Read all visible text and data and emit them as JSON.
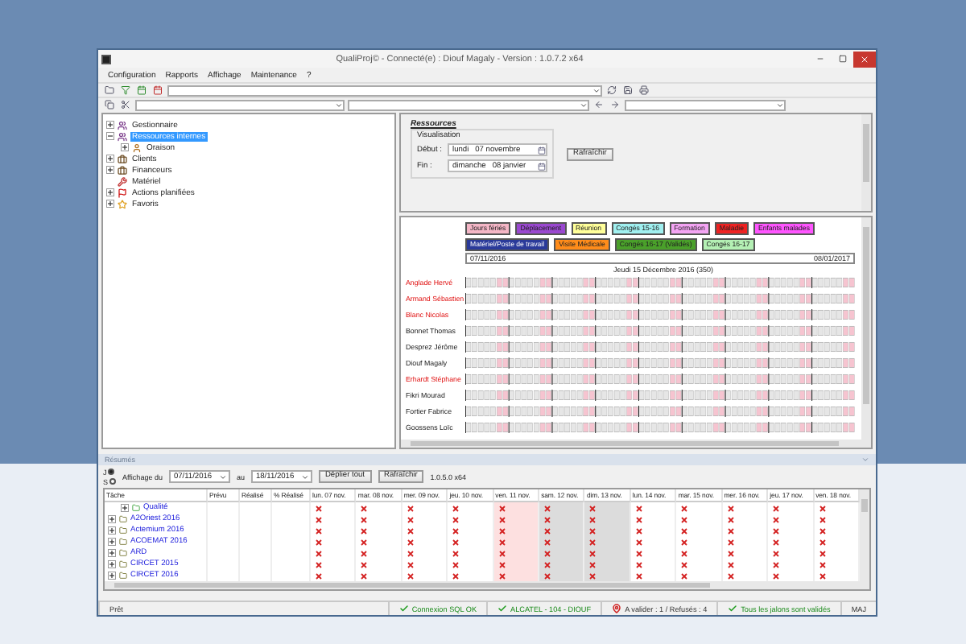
{
  "window": {
    "title": "QualiProj© - Connecté(e) : Diouf Magaly - Version : 1.0.7.2 x64"
  },
  "menu": [
    "Configuration",
    "Rapports",
    "Affichage",
    "Maintenance",
    "?"
  ],
  "tree": [
    {
      "label": "Gestionnaire",
      "kind": "group",
      "selected": false,
      "expanded": false
    },
    {
      "label": "Ressources internes",
      "kind": "group",
      "selected": true,
      "expanded": true,
      "children": [
        {
          "label": "Oraison",
          "kind": "person",
          "selected": false,
          "expanded": false
        }
      ]
    },
    {
      "label": "Clients",
      "kind": "client",
      "selected": false,
      "expanded": false
    },
    {
      "label": "Financeurs",
      "kind": "client",
      "selected": false,
      "expanded": false
    },
    {
      "label": "Matériel",
      "kind": "tool",
      "selected": false
    },
    {
      "label": "Actions planifiées",
      "kind": "flag",
      "selected": false,
      "expanded": false
    },
    {
      "label": "Favoris",
      "kind": "star",
      "selected": false,
      "expanded": false
    }
  ],
  "resources": {
    "title": "Ressources",
    "group": "Visualisation",
    "start": {
      "label": "Début :",
      "day": "lundi",
      "date": "07 novembre"
    },
    "end": {
      "label": "Fin :",
      "day": "dimanche",
      "date": "08 janvier"
    },
    "button": "Rafraîchir"
  },
  "planning": {
    "legend": [
      {
        "label": "Jours fériés",
        "color": "#f4b6c6"
      },
      {
        "label": "Déplacement",
        "color": "#9a48d0"
      },
      {
        "label": "Réunion",
        "color": "#ffff99"
      },
      {
        "label": "Congés 15-16",
        "color": "#a0f0f0"
      },
      {
        "label": "Formation",
        "color": "#f4a4f4"
      },
      {
        "label": "Maladie",
        "color": "#ee2222"
      },
      {
        "label": "Enfants malades",
        "color": "#ff55ff"
      },
      {
        "label": "Matériel/Poste de travail",
        "color": "#2a3a9a"
      },
      {
        "label": "Visite Médicale",
        "color": "#ff8c1a"
      },
      {
        "label": "Congés 16-17 (Validés)",
        "color": "#4aa02a"
      },
      {
        "label": "Congés 16-17",
        "color": "#b4f0b4"
      }
    ],
    "range_start": "07/11/2016",
    "range_end": "08/01/2017",
    "focus_date": "Jeudi 15 Décembre 2016 (350)",
    "rows": [
      {
        "name": "Anglade Hervé",
        "flagged": true
      },
      {
        "name": "Armand Sébastien",
        "flagged": true
      },
      {
        "name": "Blanc Nicolas",
        "flagged": true
      },
      {
        "name": "Bonnet Thomas",
        "flagged": false
      },
      {
        "name": "Desprez Jérôme",
        "flagged": false
      },
      {
        "name": "Diouf Magaly",
        "flagged": false
      },
      {
        "name": "Erhardt Stéphane",
        "flagged": true
      },
      {
        "name": "Fikri Mourad",
        "flagged": false
      },
      {
        "name": "Fortier Fabrice",
        "flagged": false
      },
      {
        "name": "Goossens Loïc",
        "flagged": false
      }
    ]
  },
  "summary": {
    "title": "Résumés",
    "view_options": [
      {
        "label": "J",
        "selected": true
      },
      {
        "label": "S",
        "selected": false
      }
    ],
    "from_label": "Affichage du",
    "from": "07/11/2016",
    "to_label": "au",
    "to": "18/11/2016",
    "expand_button": "Déplier tout",
    "refresh_button": "Rafraîchir",
    "version": "1.0.5.0 x64",
    "columns": [
      {
        "label": "Tâche",
        "kind": "task"
      },
      {
        "label": "Prévu",
        "kind": "number"
      },
      {
        "label": "Réalisé",
        "kind": "number"
      },
      {
        "label": "% Réalisé",
        "kind": "number"
      },
      {
        "label": "lun. 07 nov.",
        "kind": "workday"
      },
      {
        "label": "mar. 08 nov.",
        "kind": "workday"
      },
      {
        "label": "mer. 09 nov.",
        "kind": "workday"
      },
      {
        "label": "jeu. 10 nov.",
        "kind": "workday"
      },
      {
        "label": "ven. 11 nov.",
        "kind": "holiday"
      },
      {
        "label": "sam. 12 nov.",
        "kind": "weekend"
      },
      {
        "label": "dim. 13 nov.",
        "kind": "weekend"
      },
      {
        "label": "lun. 14 nov.",
        "kind": "workday"
      },
      {
        "label": "mar. 15 nov.",
        "kind": "workday"
      },
      {
        "label": "mer. 16 nov.",
        "kind": "workday"
      },
      {
        "label": "jeu. 17 nov.",
        "kind": "workday"
      },
      {
        "label": "ven. 18 nov.",
        "kind": "workday"
      }
    ],
    "rows": [
      {
        "name": "Qualité",
        "kind": "category"
      },
      {
        "name": "A2Oriest 2016",
        "kind": "project"
      },
      {
        "name": "Actemium 2016",
        "kind": "project"
      },
      {
        "name": "ACOEMAT 2016",
        "kind": "project"
      },
      {
        "name": "ARD",
        "kind": "project"
      },
      {
        "name": "CIRCET 2015",
        "kind": "project"
      },
      {
        "name": "CIRCET 2016",
        "kind": "project"
      }
    ]
  },
  "status_bar": [
    {
      "text": "Prêt",
      "kind": "plain"
    },
    {
      "text": "Connexion SQL OK",
      "kind": "ok"
    },
    {
      "text": "ALCATEL - 104 - DIOUF",
      "kind": "ok"
    },
    {
      "text": "A valider : 1 / Refusés : 4",
      "kind": "alert"
    },
    {
      "text": "Tous les jalons sont validés",
      "kind": "ok"
    },
    {
      "text": "MAJ",
      "kind": "plain"
    }
  ]
}
